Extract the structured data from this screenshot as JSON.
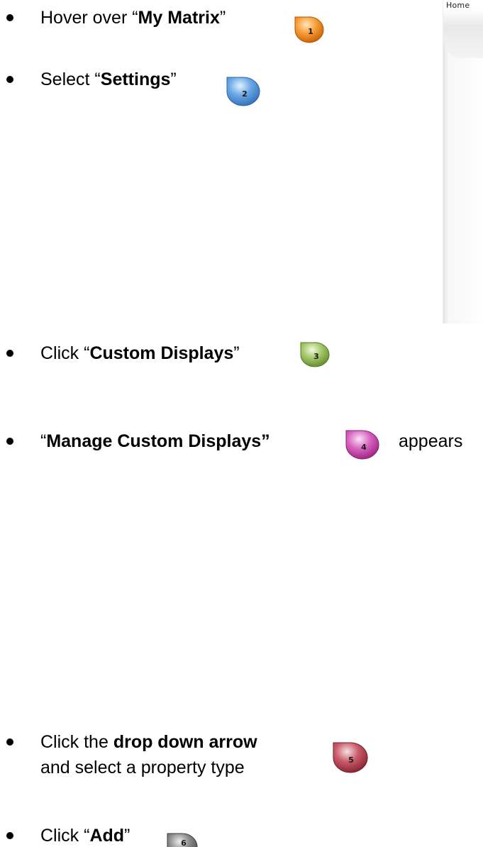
{
  "fragment": {
    "home_label": "Home"
  },
  "steps": [
    {
      "pre": "Hover over  “",
      "bold": "My Matrix",
      "post": "”",
      "badge": "1",
      "color": "#f28a1d"
    },
    {
      "pre": "Select “",
      "bold": "Settings",
      "post": "”",
      "badge": "2",
      "color": "#4f93d9"
    },
    {
      "pre": "Click “",
      "bold": "Custom Displays",
      "post": "”",
      "badge": "3",
      "color": "#8db150"
    },
    {
      "pre": "“",
      "bold": "Manage Custom Displays”",
      "post": "",
      "after": "appears",
      "badge": "4",
      "color": "#c236a6"
    },
    {
      "pre": "Click the ",
      "bold": "drop down arrow",
      "post": "",
      "line2": "and select a property type",
      "badge": "5",
      "color": "#b23344"
    },
    {
      "pre": "Click “",
      "bold": "Add",
      "post": "”",
      "badge": "6",
      "color": "#6f6f6f"
    }
  ]
}
